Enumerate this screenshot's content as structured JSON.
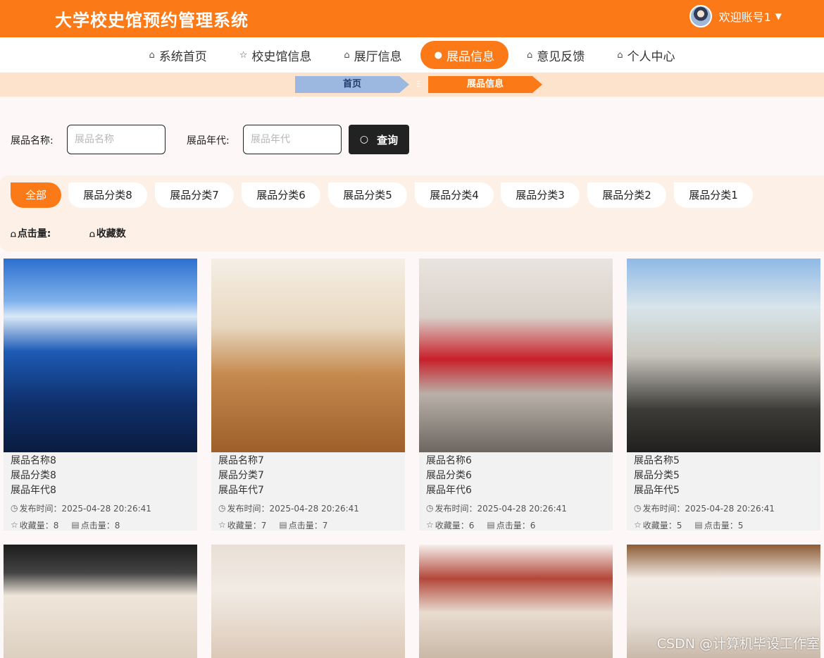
{
  "header": {
    "title": "大学校史馆预约管理系统",
    "welcome": "欢迎账号1",
    "caret_icon": "▼"
  },
  "nav": {
    "items": [
      {
        "label": "系统首页",
        "icon": "home-icon"
      },
      {
        "label": "校史馆信息",
        "icon": "star-icon"
      },
      {
        "label": "展厅信息",
        "icon": "bag-icon"
      },
      {
        "label": "展品信息",
        "icon": "info-icon"
      },
      {
        "label": "意见反馈",
        "icon": "home-icon"
      },
      {
        "label": "个人中心",
        "icon": "home-icon"
      }
    ],
    "active": "展品信息"
  },
  "breadcrumb": {
    "home": "首页",
    "separator": "Ξ",
    "current": "展品信息"
  },
  "search": {
    "name_label": "展品名称:",
    "name_placeholder": "展品名称",
    "era_label": "展品年代:",
    "era_placeholder": "展品年代",
    "button_label": "查询"
  },
  "categories": [
    "全部",
    "展品分类8",
    "展品分类7",
    "展品分类6",
    "展品分类5",
    "展品分类4",
    "展品分类3",
    "展品分类2",
    "展品分类1"
  ],
  "sort": {
    "clicks_label": "点击量:",
    "favorites_label": "收藏数"
  },
  "cards": [
    {
      "name": "展品名称8",
      "category": "展品分类8",
      "era": "展品年代8",
      "publish": "发布时间：2025-04-28 20:26:41",
      "favorites": "收藏量：8",
      "clicks": "点击量：8"
    },
    {
      "name": "展品名称7",
      "category": "展品分类7",
      "era": "展品年代7",
      "publish": "发布时间：2025-04-28 20:26:41",
      "favorites": "收藏量：7",
      "clicks": "点击量：7"
    },
    {
      "name": "展品名称6",
      "category": "展品分类6",
      "era": "展品年代6",
      "publish": "发布时间：2025-04-28 20:26:41",
      "favorites": "收藏量：6",
      "clicks": "点击量：6"
    },
    {
      "name": "展品名称5",
      "category": "展品分类5",
      "era": "展品年代5",
      "publish": "发布时间：2025-04-28 20:26:41",
      "favorites": "收藏量：5",
      "clicks": "点击量：5"
    }
  ],
  "watermark": "CSDN @计算机毕设工作室",
  "colors": {
    "accent": "#fb7a17",
    "breadcrumb_home": "#9db8e0",
    "dark_button": "#222222"
  }
}
